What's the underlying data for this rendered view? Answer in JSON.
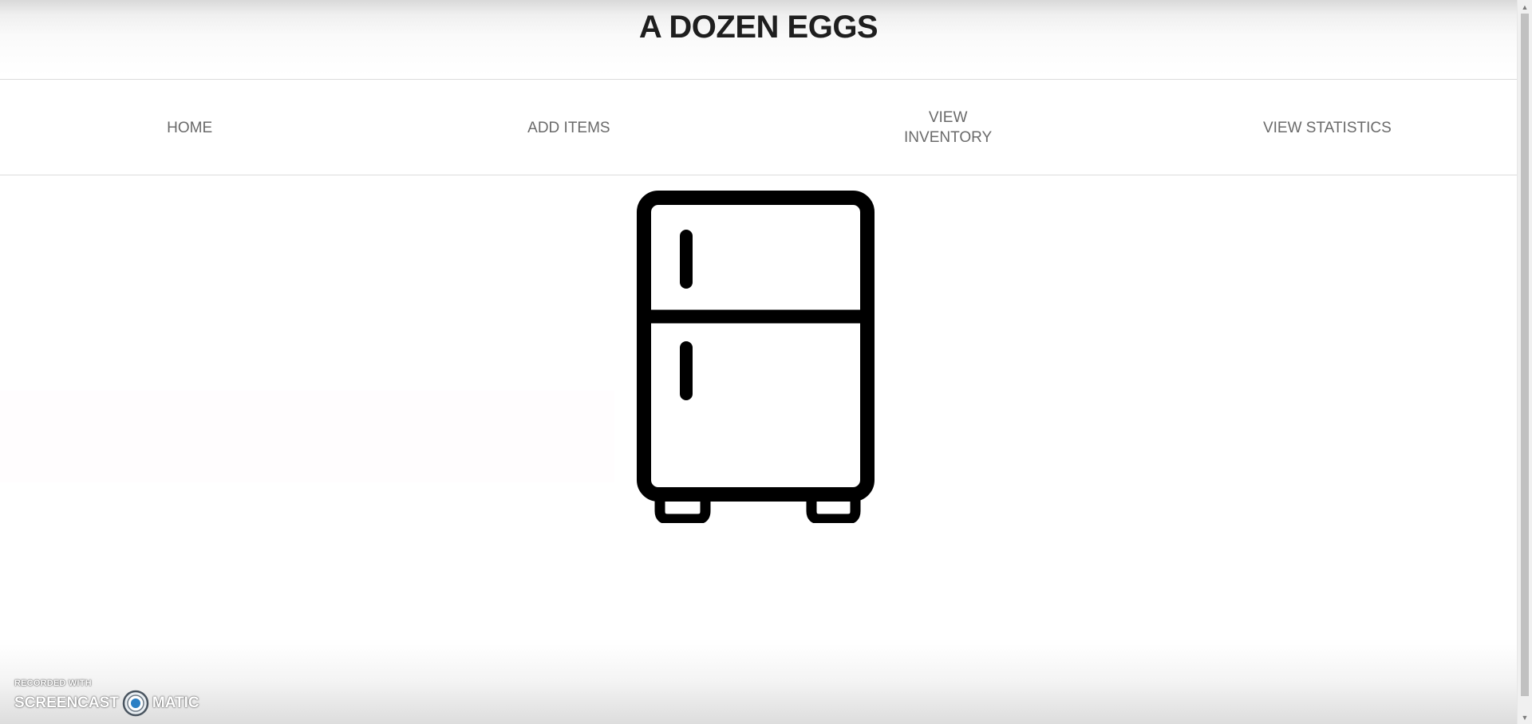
{
  "site": {
    "title": "A DOZEN EGGS"
  },
  "nav": {
    "items": [
      {
        "label": "HOME"
      },
      {
        "label": "ADD ITEMS"
      },
      {
        "label": "VIEW INVENTORY"
      },
      {
        "label": "VIEW STATISTICS"
      }
    ]
  },
  "hero": {
    "icon": "fridge-icon"
  },
  "watermark": {
    "recorded_with": "RECORDED WITH",
    "brand_left": "SCREENCAST",
    "brand_right": "MATIC"
  },
  "colors": {
    "title": "#1e1e1e",
    "nav_text": "#6a6a6a",
    "icon": "#000000"
  }
}
